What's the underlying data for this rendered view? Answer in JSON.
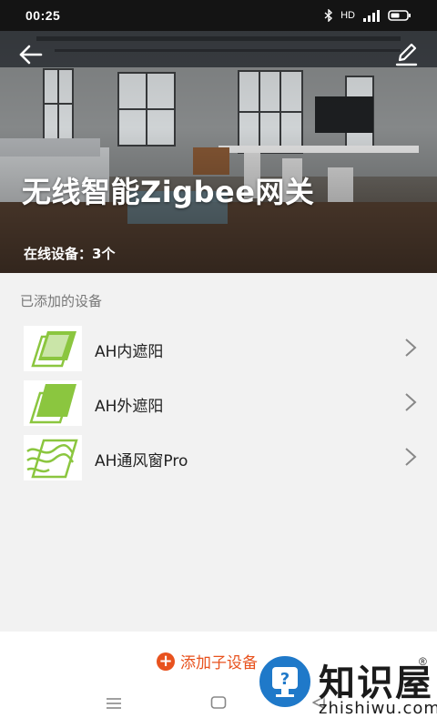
{
  "status_bar": {
    "time": "00:25",
    "network_label": "HD",
    "icons": [
      "bluetooth-icon",
      "signal-icon",
      "battery-icon"
    ]
  },
  "header": {
    "title": "无线智能Zigbee网关",
    "online_devices": "在线设备：3个",
    "icons": [
      "back-arrow-icon",
      "edit-pencil-icon"
    ]
  },
  "section": {
    "added_devices_label": "已添加的设备"
  },
  "devices": [
    {
      "name": "AH内遮阳",
      "icon": "indoor-shade-icon"
    },
    {
      "name": "AH外遮阳",
      "icon": "outdoor-shade-icon"
    },
    {
      "name": "AH通风窗Pro",
      "icon": "ventilation-window-icon"
    }
  ],
  "footer": {
    "add_sub_device_label": "添加子设备",
    "nav_icons": [
      "menu-icon",
      "home-icon",
      "back-icon"
    ]
  },
  "watermark": {
    "name": "知识屋",
    "url": "zhishiwu.com"
  },
  "colors": {
    "accent": "#e8521e",
    "icon_green": "#8bc63f",
    "status_bar": "#141414"
  }
}
